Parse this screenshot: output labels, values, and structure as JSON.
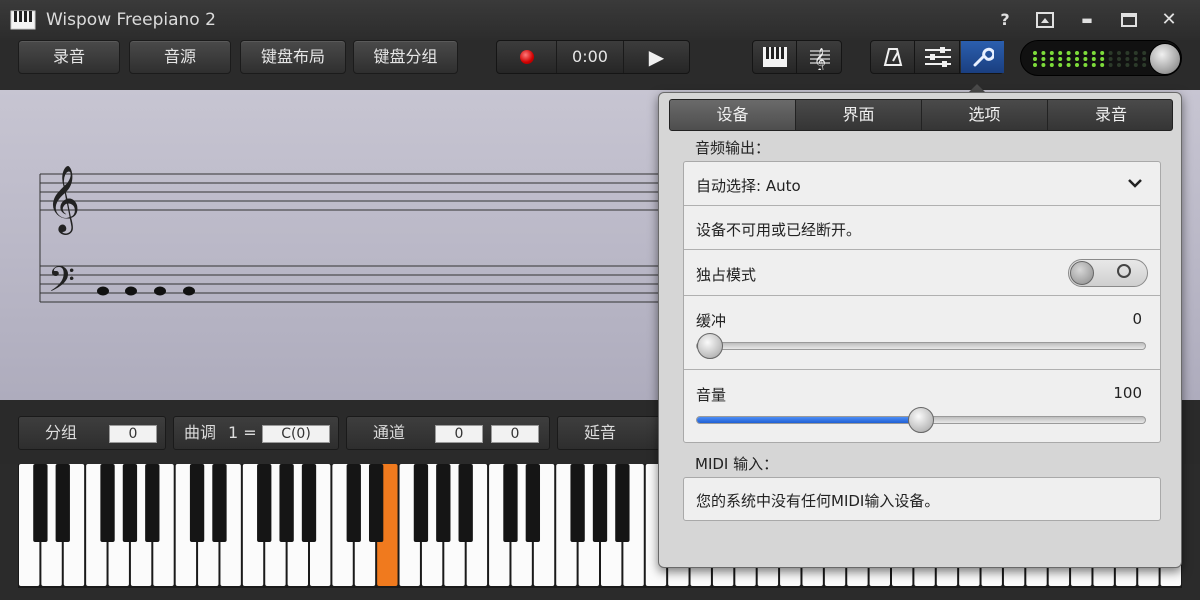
{
  "app": {
    "title": "Wispow Freepiano 2"
  },
  "window_controls": {
    "help": "?",
    "minimize": "▬",
    "maximize": "▭",
    "close": "✕"
  },
  "toolbar": {
    "buttons": [
      "录音",
      "音源",
      "键盘布局",
      "键盘分组"
    ],
    "time": "0:00"
  },
  "view_icons": [
    "piano-view-icon",
    "sheet-music-view-icon"
  ],
  "tool_icons": [
    "metronome-icon",
    "mixer-sliders-icon",
    "wrench-settings-icon"
  ],
  "info_bar": {
    "group_label": "分组",
    "group_value": "0",
    "key_label": "曲调",
    "key_eq": "1 =",
    "key_value": "C(0)",
    "channel_label": "通道",
    "channel_value1": "0",
    "channel_value2": "0",
    "sustain_label": "延音"
  },
  "settings": {
    "tabs": [
      "设备",
      "界面",
      "选项",
      "录音"
    ],
    "active_tab": 0,
    "audio_output_label": "音频输出：",
    "device_select": "自动选择: Auto",
    "device_status": "设备不可用或已经断开。",
    "exclusive_label": "独占模式",
    "exclusive_on": false,
    "buffer_label": "缓冲",
    "buffer_value": "0",
    "buffer_level": 0,
    "volume_label": "音量",
    "volume_value": "100",
    "volume_level": 0.5,
    "midi_label": "MIDI 输入：",
    "midi_status": "您的系统中没有任何MIDI输入设备。"
  },
  "colors": {
    "accent_blue": "#2a6fd9",
    "pressed_key": "#f07a1e",
    "led_green": "#7ddc3a",
    "record_red": "#d00000"
  }
}
